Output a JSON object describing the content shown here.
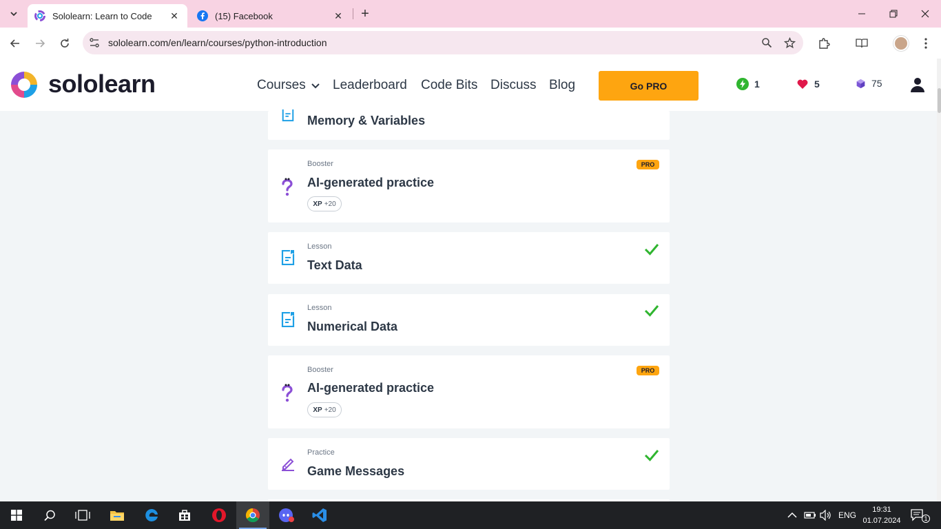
{
  "browser": {
    "tabs": [
      {
        "title": "Sololearn: Learn to Code",
        "active": true
      },
      {
        "title": "(15) Facebook",
        "active": false
      }
    ],
    "url": "sololearn.com/en/learn/courses/python-introduction"
  },
  "header": {
    "logo_text": "sololearn",
    "nav": {
      "courses": "Courses",
      "leaderboard": "Leaderboard",
      "code_bits": "Code Bits",
      "discuss": "Discuss",
      "blog": "Blog"
    },
    "go_pro": "Go PRO",
    "streak": "1",
    "hearts": "5",
    "bits": "75"
  },
  "cards": [
    {
      "kind": "",
      "title": "Memory & Variables",
      "icon": "lesson-icon"
    },
    {
      "kind": "Booster",
      "title": "AI-generated practice",
      "badge": "PRO",
      "xp_label": "XP",
      "xp_value": "+20",
      "icon": "booster-icon"
    },
    {
      "kind": "Lesson",
      "title": "Text Data",
      "completed": true,
      "icon": "lesson-icon"
    },
    {
      "kind": "Lesson",
      "title": "Numerical Data",
      "completed": true,
      "icon": "lesson-icon"
    },
    {
      "kind": "Booster",
      "title": "AI-generated practice",
      "badge": "PRO",
      "xp_label": "XP",
      "xp_value": "+20",
      "icon": "booster-icon"
    },
    {
      "kind": "Practice",
      "title": "Game Messages",
      "completed": true,
      "icon": "practice-icon"
    }
  ],
  "taskbar": {
    "language": "ENG",
    "time": "19:31",
    "date": "01.07.2024",
    "notifications": "1"
  },
  "colors": {
    "accent_orange": "#fea510",
    "lesson_blue": "#1ea0e6",
    "booster_purple": "#8b4fd6",
    "check_green": "#2fb52f",
    "page_bg": "#f2f5f7"
  }
}
